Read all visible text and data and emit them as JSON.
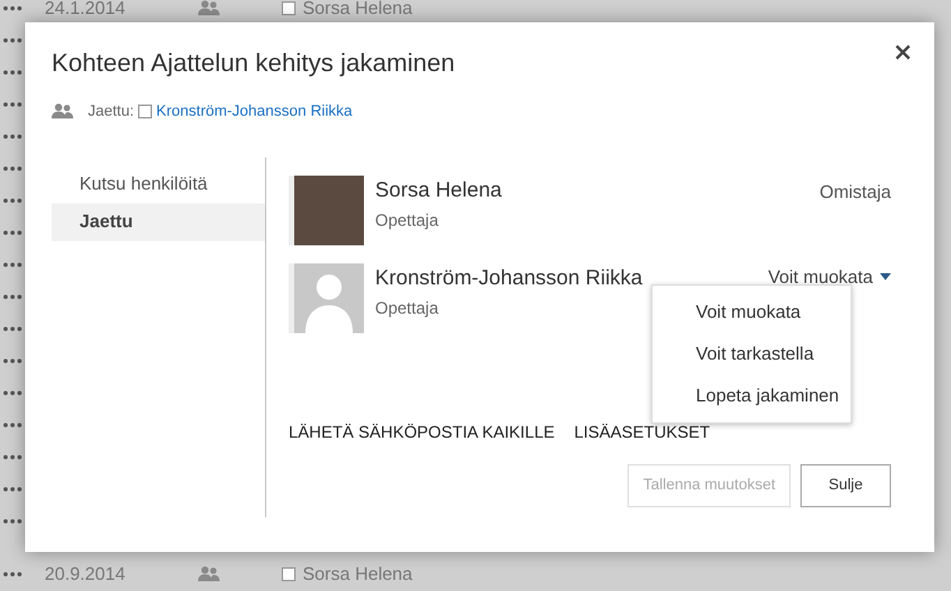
{
  "background_rows": [
    {
      "date": "24.1.2014",
      "owner": "Sorsa Helena",
      "checked": false
    },
    {
      "date": "20.9.2014",
      "owner": "Sorsa Helena",
      "checked": false
    }
  ],
  "dialog": {
    "title": "Kohteen Ajattelun kehitys jakaminen",
    "shared_label": "Jaettu:",
    "shared_checked": false,
    "shared_with": "Kronström-Johansson Riikka",
    "nav": [
      {
        "label": "Kutsu henkilöitä",
        "selected": false
      },
      {
        "label": "Jaettu",
        "selected": true
      }
    ],
    "people": [
      {
        "kind": "owner",
        "name": "Sorsa Helena",
        "role": "Opettaja",
        "permission": "Omistaja"
      },
      {
        "kind": "member",
        "name": "Kronström-Johansson Riikka",
        "role": "Opettaja",
        "permission": "Voit muokata"
      }
    ],
    "menu": [
      "Voit muokata",
      "Voit tarkastella",
      "Lopeta jakaminen"
    ],
    "actions": [
      "LÄHETÄ SÄHKÖPOSTIA KAIKILLE",
      "LISÄASETUKSET"
    ],
    "buttons": [
      {
        "label": "Tallenna muutokset",
        "disabled": true
      },
      {
        "label": "Sulje",
        "disabled": false
      }
    ]
  }
}
